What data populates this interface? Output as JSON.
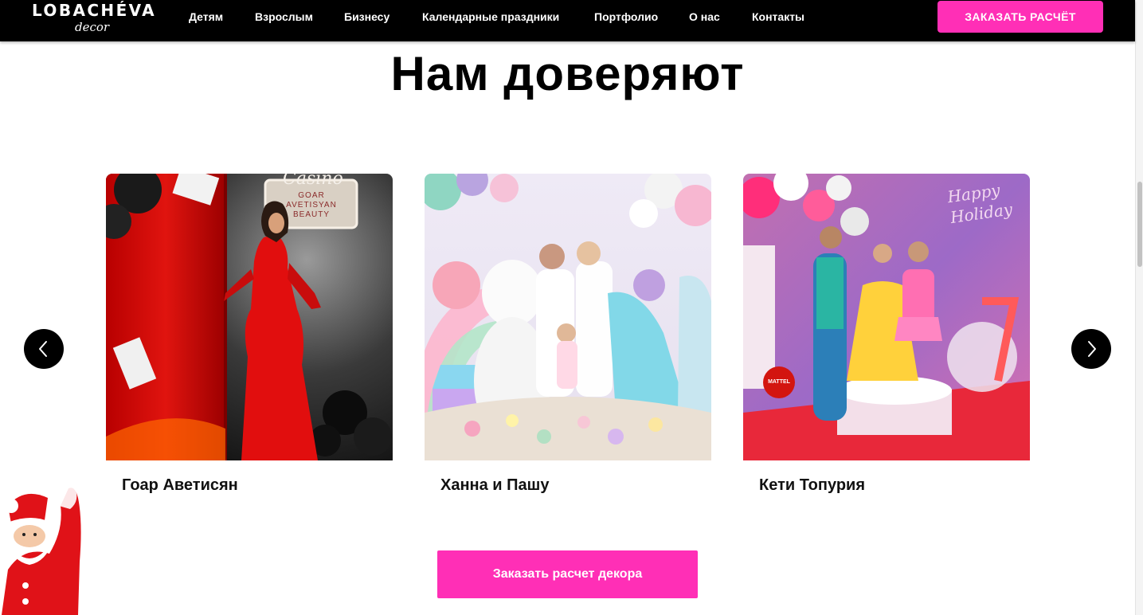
{
  "header": {
    "logo_main": "LOBACHÉVA",
    "logo_sub": "decor",
    "nav": [
      {
        "label": "Детям"
      },
      {
        "label": "Взрослым"
      },
      {
        "label": "Бизнесу"
      },
      {
        "label": "Календарные праздники"
      },
      {
        "label": "Портфолио"
      },
      {
        "label": "О нас"
      },
      {
        "label": "Контакты"
      }
    ],
    "cta_label": "ЗАКАЗАТЬ РАСЧЁТ"
  },
  "section": {
    "title": "Нам доверяют"
  },
  "carousel": {
    "cards": [
      {
        "name": "Гоар Аветисян",
        "photo_sign": "GOAR AVETISYAN BEAUTY",
        "photo_script": "Casino"
      },
      {
        "name": "Ханна и Пашу"
      },
      {
        "name": "Кети Топурия",
        "photo_script": "Happy Holiday",
        "photo_badge": "MATTEL"
      }
    ],
    "prev_icon": "chevron-left-icon",
    "next_icon": "chevron-right-icon"
  },
  "main_cta_label": "Заказать расчет декора",
  "colors": {
    "accent": "#ff2fb6",
    "header_bg": "#000000"
  }
}
